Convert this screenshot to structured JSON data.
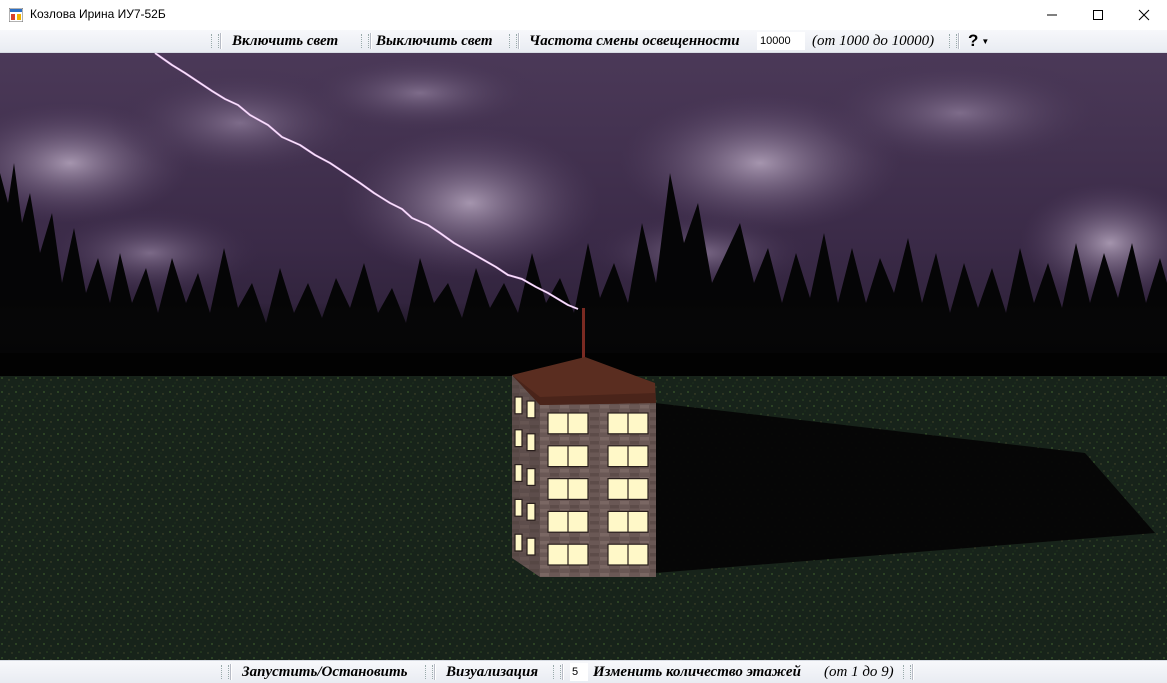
{
  "window": {
    "title": "Козлова Ирина ИУ7-52Б"
  },
  "top_toolbar": {
    "light_on_label": "Включить свет",
    "light_off_label": "Выключить свет",
    "frequency_label": "Частота смены освещенности",
    "frequency_value": "10000",
    "frequency_range": "(от 1000 до 10000)",
    "help_label": "?"
  },
  "bottom_toolbar": {
    "start_stop_label": "Запустить/Остановить",
    "visualization_label": "Визуализация",
    "floors_value": "5",
    "change_floors_label": "Изменить количество этажей",
    "floors_range": "(от 1 до 9)"
  },
  "scene": {
    "floors": 5,
    "colors": {
      "sky": "#3a2a47",
      "grass": "#1d2b17",
      "roof": "#5a2d20",
      "wall": "#6b5a57",
      "window_lit": "#fff8c8",
      "lightning": "#e8b8f0"
    }
  }
}
